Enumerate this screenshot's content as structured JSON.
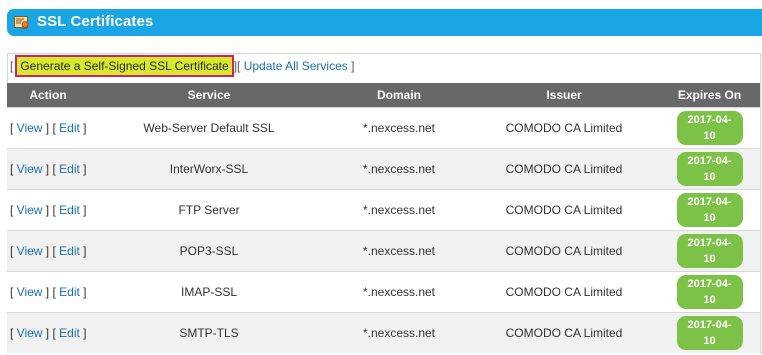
{
  "header": {
    "title": "SSL Certificates"
  },
  "toolbar": {
    "open_bracket": "[",
    "generate_label": "Generate a Self-Signed SSL Certificate",
    "separator": "][",
    "update_label": "Update All Services",
    "close_bracket": "]"
  },
  "table": {
    "columns": [
      "Action",
      "Service",
      "Domain",
      "Issuer",
      "Expires On"
    ],
    "action_links": {
      "view": "View",
      "edit": "Edit"
    },
    "rows": [
      {
        "service": "Web-Server Default SSL",
        "domain": "*.nexcess.net",
        "issuer": "COMODO CA Limited",
        "expires_line1": "2017-04-",
        "expires_line2": "10"
      },
      {
        "service": "InterWorx-SSL",
        "domain": "*.nexcess.net",
        "issuer": "COMODO CA Limited",
        "expires_line1": "2017-04-",
        "expires_line2": "10"
      },
      {
        "service": "FTP Server",
        "domain": "*.nexcess.net",
        "issuer": "COMODO CA Limited",
        "expires_line1": "2017-04-",
        "expires_line2": "10"
      },
      {
        "service": "POP3-SSL",
        "domain": "*.nexcess.net",
        "issuer": "COMODO CA Limited",
        "expires_line1": "2017-04-",
        "expires_line2": "10"
      },
      {
        "service": "IMAP-SSL",
        "domain": "*.nexcess.net",
        "issuer": "COMODO CA Limited",
        "expires_line1": "2017-04-",
        "expires_line2": "10"
      },
      {
        "service": "SMTP-TLS",
        "domain": "*.nexcess.net",
        "issuer": "COMODO CA Limited",
        "expires_line1": "2017-04-",
        "expires_line2": "10"
      }
    ]
  },
  "colors": {
    "title_bar": "#1aa5e5",
    "header_row": "#686868",
    "expires_badge": "#7cc246",
    "generate_highlight": "#d7e82d",
    "generate_outline": "#cc2266",
    "link": "#1a6fb5"
  },
  "icons": {
    "title_icon": "certificate-icon"
  }
}
